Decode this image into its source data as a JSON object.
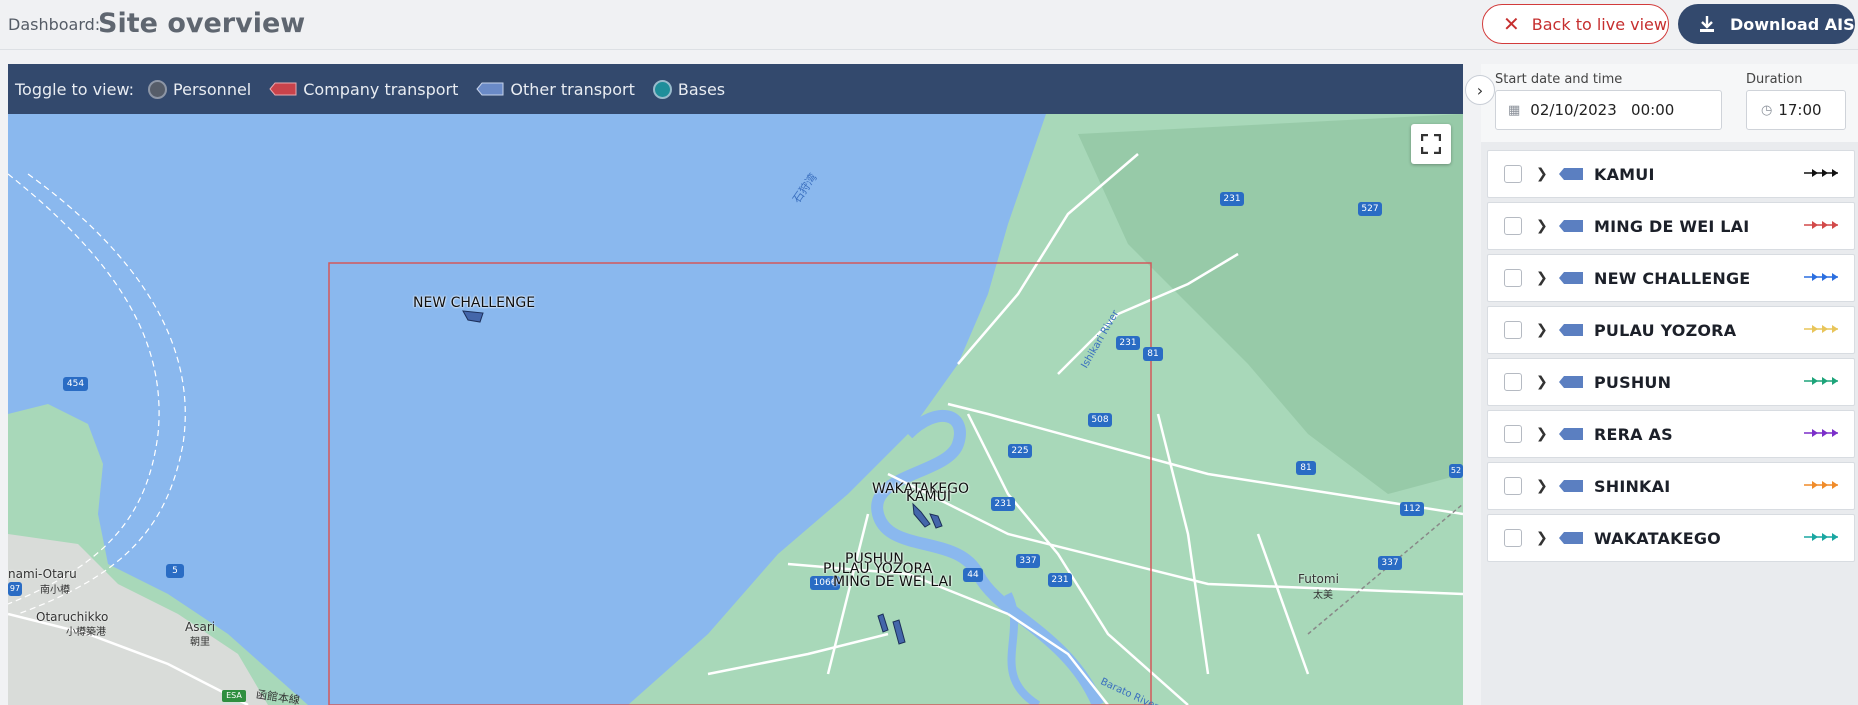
{
  "header": {
    "breadcrumb": "Dashboard:",
    "title": "Site overview",
    "back_label": "Back to live view",
    "download_label": "Download AIS"
  },
  "toolbar": {
    "prefix": "Toggle to view:",
    "toggles": [
      {
        "label": "Personnel",
        "icon": "personnel-circle-icon"
      },
      {
        "label": "Company transport",
        "icon": "company-transport-icon",
        "color": "#c9434b"
      },
      {
        "label": "Other transport",
        "icon": "other-transport-icon",
        "color": "#6a8ac7"
      },
      {
        "label": "Bases",
        "icon": "bases-circle-icon",
        "color": "#1f8e9a"
      }
    ]
  },
  "map": {
    "colors": {
      "water": "#8ab8ee",
      "land": "#a8d8b9",
      "roads": "#ffffff",
      "site_box": "#d2585b",
      "vessel": "#4466aa"
    },
    "sea_label": "石狩湾",
    "river_labels": [
      "Ishikari River",
      "Barato River"
    ],
    "place_labels": [
      {
        "text": "Otaruchikko",
        "sub": "小樽築港"
      },
      {
        "text": "Asari",
        "sub": "朝里"
      },
      {
        "text": "nami-Otaru",
        "sub": "南小樽"
      },
      {
        "text": "Futomi",
        "sub": "太美"
      },
      {
        "text": "函館本線"
      }
    ],
    "route_shields": [
      "454",
      "231",
      "527",
      "231",
      "81",
      "508",
      "225",
      "81",
      "231",
      "112",
      "337",
      "337",
      "231",
      "44",
      "1066",
      "5",
      "52",
      "97",
      "ESA"
    ],
    "vessel_labels": [
      {
        "text": "NEW CHALLENGE"
      },
      {
        "text": "WAKATAKEGO"
      },
      {
        "text": "KAMUI"
      },
      {
        "text": "PUSHUN"
      },
      {
        "text": "PULAU YOZORA"
      },
      {
        "text": "MING DE WEI LAI"
      }
    ]
  },
  "panel": {
    "start_label": "Start date and time",
    "start_value": "02/10/2023   00:00",
    "duration_label": "Duration",
    "duration_value": "17:00",
    "vessels": [
      {
        "name": "KAMUI",
        "track_color": "#111111"
      },
      {
        "name": "MING DE WEI LAI",
        "track_color": "#d24a4a"
      },
      {
        "name": "NEW CHALLENGE",
        "track_color": "#2b6fe0"
      },
      {
        "name": "PULAU YOZORA",
        "track_color": "#e8c55a"
      },
      {
        "name": "PUSHUN",
        "track_color": "#1ea47a"
      },
      {
        "name": "RERA AS",
        "track_color": "#7b2fc9"
      },
      {
        "name": "SHINKAI",
        "track_color": "#f08c2a"
      },
      {
        "name": "WAKATAKEGO",
        "track_color": "#1aa7a2"
      }
    ]
  }
}
